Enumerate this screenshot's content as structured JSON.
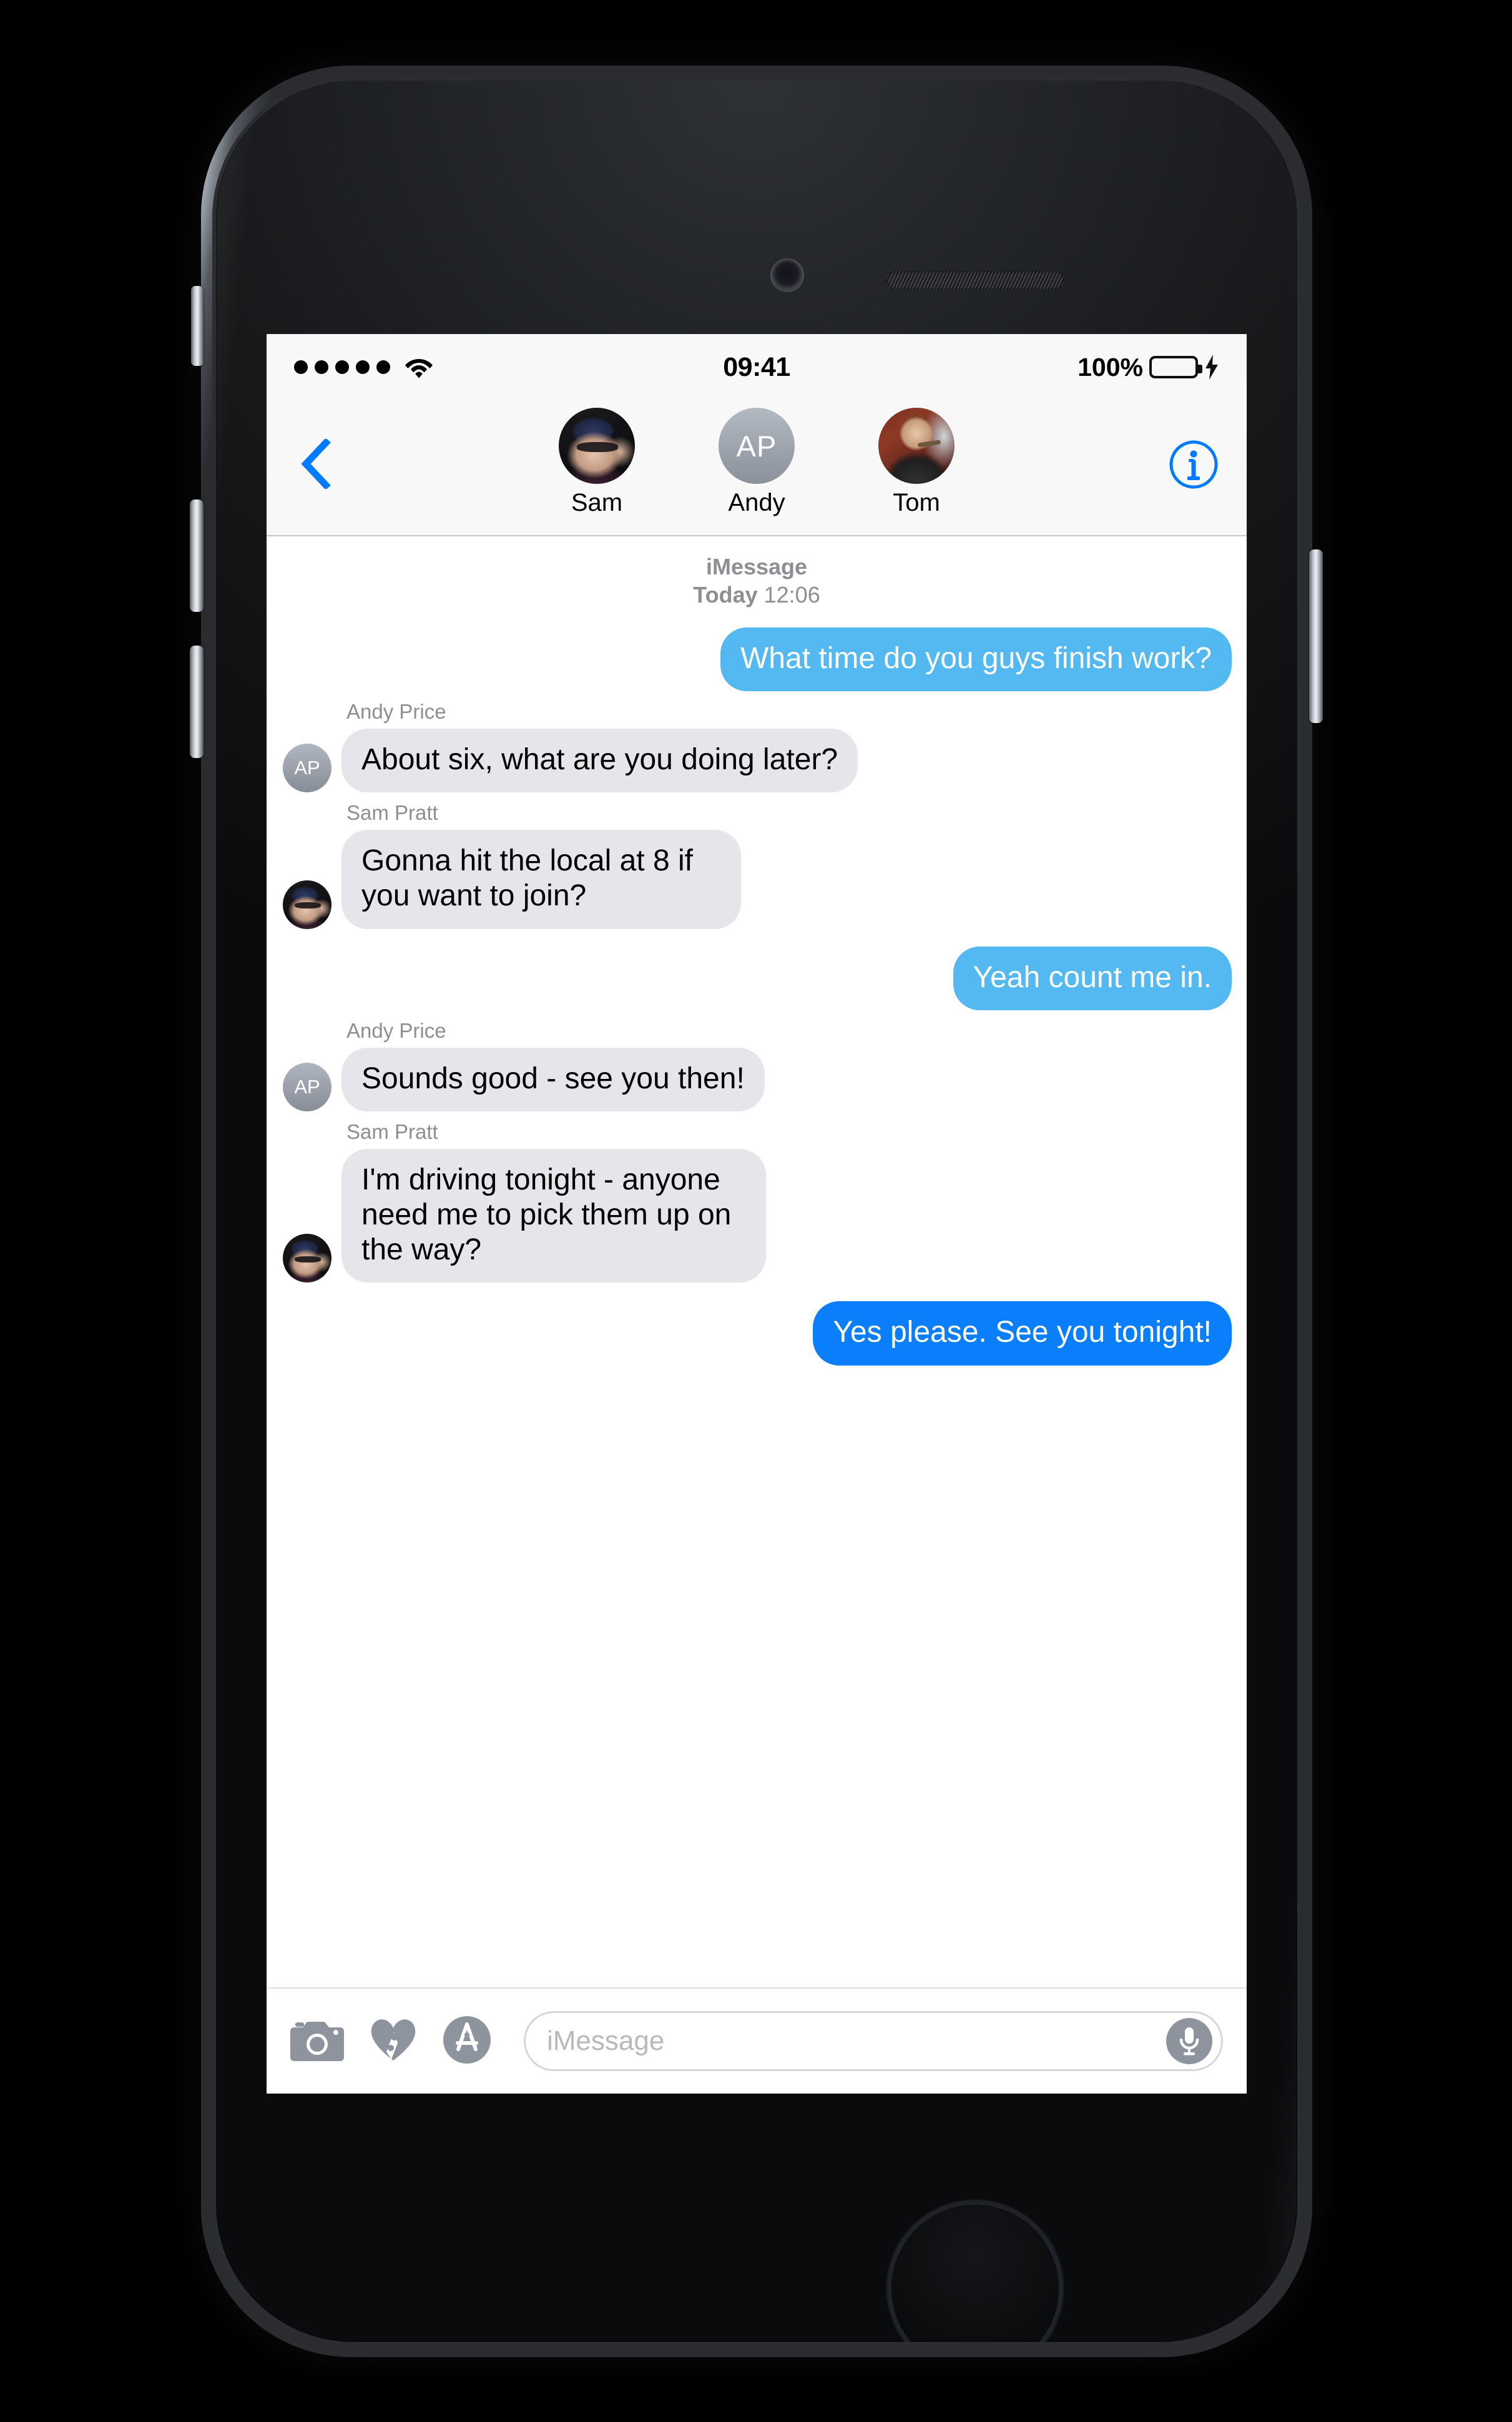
{
  "status_bar": {
    "signal_dots": 5,
    "wifi_icon": "wifi-icon",
    "time": "09:41",
    "battery_percent": "100%",
    "battery_icon": "battery-full-charging-icon"
  },
  "nav_bar": {
    "back_icon": "chevron-left-icon",
    "info_icon": "info-circle-icon",
    "participants": [
      {
        "name": "Sam",
        "avatar_type": "photo",
        "avatar_name": "avatar-sam-photo",
        "initials": ""
      },
      {
        "name": "Andy",
        "avatar_type": "initials",
        "avatar_name": "avatar-andy-initials",
        "initials": "AP"
      },
      {
        "name": "Tom",
        "avatar_type": "photo",
        "avatar_name": "avatar-tom-photo",
        "initials": ""
      }
    ]
  },
  "conversation": {
    "service_label": "iMessage",
    "day_label": "Today",
    "time_label": "12:06",
    "messages": [
      {
        "direction": "outgoing",
        "sender": "",
        "text": "What time do you guys finish work?",
        "bubble_color": "#54b9f0",
        "show_avatar": false,
        "avatar_type": "",
        "initials": ""
      },
      {
        "direction": "incoming",
        "sender": "Andy Price",
        "text": "About six, what are you doing later?",
        "bubble_color": "#e5e5ea",
        "show_avatar": true,
        "avatar_type": "initials",
        "initials": "AP"
      },
      {
        "direction": "incoming",
        "sender": "Sam Pratt",
        "text": "Gonna hit the local at 8 if you want to join?",
        "bubble_color": "#e5e5ea",
        "show_avatar": true,
        "avatar_type": "photo-sam",
        "initials": ""
      },
      {
        "direction": "outgoing",
        "sender": "",
        "text": "Yeah count me in.",
        "bubble_color": "#2196f3",
        "show_avatar": false,
        "avatar_type": "",
        "initials": ""
      },
      {
        "direction": "incoming",
        "sender": "Andy Price",
        "text": "Sounds good - see you then!",
        "bubble_color": "#e5e5ea",
        "show_avatar": true,
        "avatar_type": "initials",
        "initials": "AP"
      },
      {
        "direction": "incoming",
        "sender": "Sam Pratt",
        "text": "I'm driving tonight - anyone need me to pick them up on the way?",
        "bubble_color": "#e5e5ea",
        "show_avatar": true,
        "avatar_type": "photo-sam",
        "initials": ""
      },
      {
        "direction": "outgoing",
        "sender": "",
        "text": "Yes please. See you tonight!",
        "bubble_color": "#0b7ffb",
        "show_avatar": false,
        "avatar_type": "",
        "initials": ""
      }
    ]
  },
  "input_toolbar": {
    "camera_icon": "camera-icon",
    "digital_touch_icon": "digital-touch-heart-icon",
    "app_store_icon": "app-store-icon",
    "placeholder": "iMessage",
    "mic_icon": "microphone-icon"
  },
  "colors": {
    "accent_blue": "#007aff",
    "bubble_blue_light": "#54b9f0",
    "bubble_blue_vivid": "#0b7ffb",
    "bubble_grey": "#e5e5ea",
    "secondary_text": "#8e8e93",
    "battery_green": "#4cd964",
    "toolbar_icon_grey": "#8e949e",
    "nav_background": "#f8f8f8"
  },
  "device": {
    "body_color": "#1a1c1e",
    "frame_color": "#9aa0a8"
  }
}
